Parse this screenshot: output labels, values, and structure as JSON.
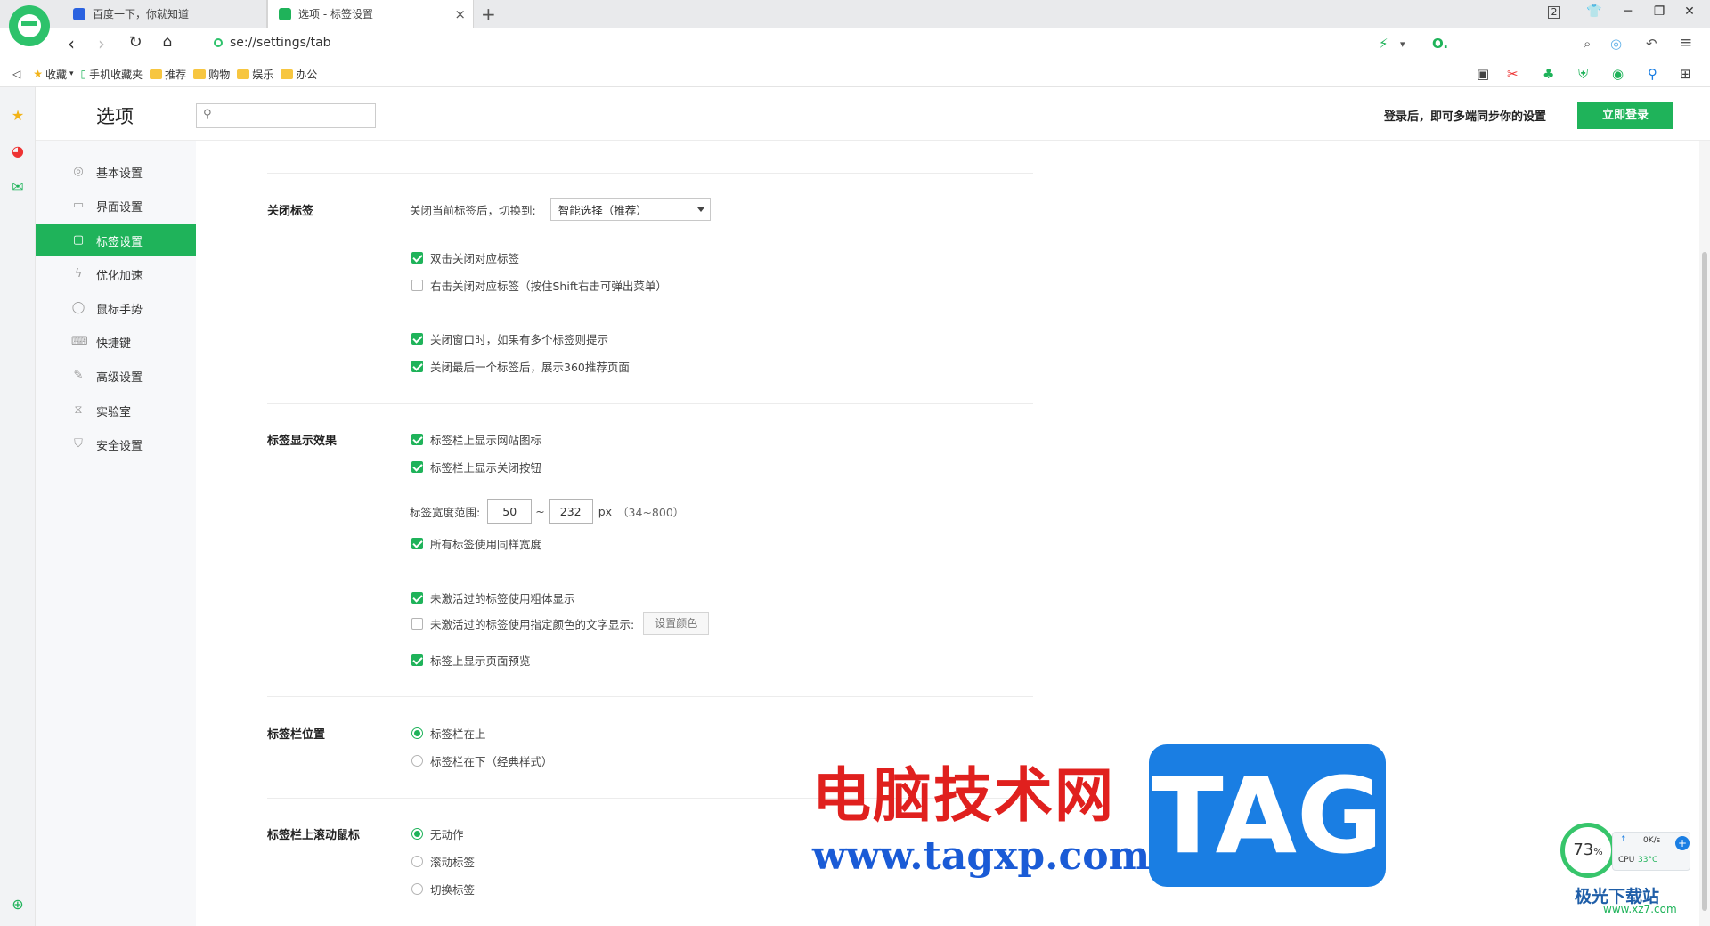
{
  "tabs": [
    {
      "title": "百度一下，你就知道",
      "active": false,
      "favicon_color": "#2a62e0"
    },
    {
      "title": "选项 - 标签设置",
      "active": true,
      "favicon_color": "#1fb35a"
    }
  ],
  "window_controls": {
    "badge": "2"
  },
  "address": {
    "url": "se://settings/tab"
  },
  "bookmarks": {
    "items": [
      {
        "label": "收藏",
        "icon": "star-icon"
      },
      {
        "label": "手机收藏夹",
        "icon": "phone-icon"
      },
      {
        "label": "推荐",
        "icon": "folder-icon"
      },
      {
        "label": "购物",
        "icon": "folder-icon"
      },
      {
        "label": "娱乐",
        "icon": "folder-icon"
      },
      {
        "label": "办公",
        "icon": "folder-icon"
      }
    ]
  },
  "header": {
    "title": "选项",
    "search_placeholder": "",
    "sync_text": "登录后，即可多端同步你的设置",
    "login_label": "立即登录"
  },
  "nav": {
    "items": [
      {
        "label": "基本设置",
        "icon": "circle-gear-icon",
        "active": false
      },
      {
        "label": "界面设置",
        "icon": "window-icon",
        "active": false
      },
      {
        "label": "标签设置",
        "icon": "tab-icon",
        "active": true
      },
      {
        "label": "优化加速",
        "icon": "lightning-icon",
        "active": false
      },
      {
        "label": "鼠标手势",
        "icon": "mouse-icon",
        "active": false
      },
      {
        "label": "快捷键",
        "icon": "keyboard-icon",
        "active": false
      },
      {
        "label": "高级设置",
        "icon": "wrench-icon",
        "active": false
      },
      {
        "label": "实验室",
        "icon": "flask-icon",
        "active": false
      },
      {
        "label": "安全设置",
        "icon": "shield-icon",
        "active": false
      }
    ]
  },
  "sections": {
    "close_tab": {
      "title": "关闭标签",
      "switch_label": "关闭当前标签后，切换到:",
      "switch_value": "智能选择（推荐）",
      "options": [
        {
          "label": "双击关闭对应标签",
          "checked": true
        },
        {
          "label": "右击关闭对应标签（按住Shift右击可弹出菜单）",
          "checked": false
        },
        {
          "label": "关闭窗口时，如果有多个标签则提示",
          "checked": true
        },
        {
          "label": "关闭最后一个标签后，展示360推荐页面",
          "checked": true
        }
      ]
    },
    "display": {
      "title": "标签显示效果",
      "options_top": [
        {
          "label": "标签栏上显示网站图标",
          "checked": true
        },
        {
          "label": "标签栏上显示关闭按钮",
          "checked": true
        }
      ],
      "width_label": "标签宽度范围:",
      "width_min": "50",
      "width_sep": "~",
      "width_max": "232",
      "width_unit": "px",
      "width_range": "（34~800）",
      "same_width": {
        "label": "所有标签使用同样宽度",
        "checked": true
      },
      "bold_inactive": {
        "label": "未激活过的标签使用粗体显示",
        "checked": true
      },
      "color_inactive": {
        "label": "未激活过的标签使用指定颜色的文字显示:",
        "checked": false
      },
      "set_color_label": "设置颜色",
      "preview": {
        "label": "标签上显示页面预览",
        "checked": true
      }
    },
    "position": {
      "title": "标签栏位置",
      "options": [
        {
          "label": "标签栏在上",
          "selected": true
        },
        {
          "label": "标签栏在下（经典样式）",
          "selected": false
        }
      ]
    },
    "scroll": {
      "title": "标签栏上滚动鼠标",
      "options": [
        {
          "label": "无动作",
          "selected": true
        },
        {
          "label": "滚动标签",
          "selected": false
        },
        {
          "label": "切换标签",
          "selected": false
        }
      ]
    }
  },
  "watermark": {
    "cn": "电脑技术网",
    "url": "www.tagxp.com",
    "tag": "TAG"
  },
  "cpu_widget": {
    "percent": "73",
    "percent_unit": "%",
    "speed": "0K/s",
    "label": "CPU",
    "temp": "33°C"
  },
  "corner_logo": {
    "name": "极光下载站",
    "url": "www.xz7.com"
  },
  "colors": {
    "accent": "#1fb35a",
    "brand_logo": "#2dc26b"
  }
}
